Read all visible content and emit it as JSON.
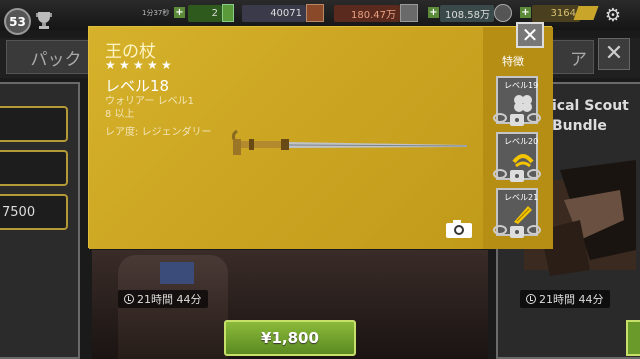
{
  "topbar": {
    "player_level": "53",
    "timer": "1分37秒",
    "resources": [
      {
        "name": "energy",
        "value": "2",
        "color": "#2e5a1e"
      },
      {
        "name": "iron",
        "value": "40071",
        "color": "#3a3a4a"
      },
      {
        "name": "cash",
        "value": "180.47万",
        "color": "#5a2a1e"
      },
      {
        "name": "supplies",
        "value": "108.58万",
        "color": "#3a4a4a"
      },
      {
        "name": "gold",
        "value": "3164",
        "color": "#4a4020"
      }
    ]
  },
  "shop": {
    "tab_pack": "パック",
    "tab_store": "ア",
    "left_rows": [
      "",
      "",
      "7500"
    ],
    "bundle_name": "ical Scout\nBundle",
    "timer_left": "21時間 44分",
    "timer_right": "21時間 44分",
    "price": "¥1,800"
  },
  "popup": {
    "item_name": "王の杖",
    "stars": 5,
    "level": "レベル18",
    "requirement": "ウォリアー レベル1\n8 以上",
    "rarity": "レア度: レジェンダリー",
    "features_label": "特徴",
    "features": [
      {
        "level": "レベル19",
        "icon": "clover-icon"
      },
      {
        "level": "レベル20",
        "icon": "bounce-icon"
      },
      {
        "level": "レベル21",
        "icon": "blade-icon"
      }
    ],
    "close_label": "✕"
  },
  "colors": {
    "popup_gold": "#c8a21d",
    "accent_green": "#8cba3a"
  }
}
